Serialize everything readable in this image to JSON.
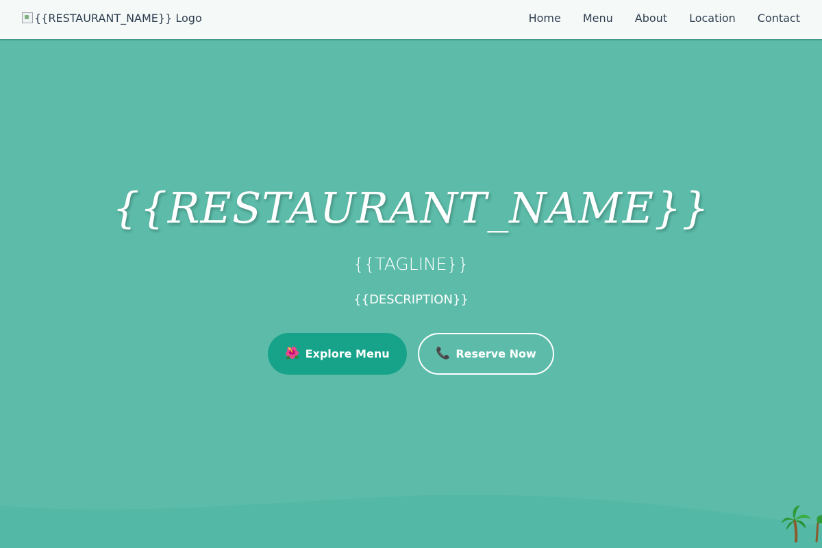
{
  "header": {
    "logo_alt": "{{RESTAURANT_NAME}} Logo",
    "nav": [
      {
        "label": "Home"
      },
      {
        "label": "Menu"
      },
      {
        "label": "About"
      },
      {
        "label": "Location"
      },
      {
        "label": "Contact"
      }
    ]
  },
  "hero": {
    "title": "{{RESTAURANT_NAME}}",
    "tagline": "{{TAGLINE}}",
    "description": "{{DESCRIPTION}}",
    "primary_button": {
      "icon": "🌺",
      "label": "Explore Menu",
      "icon_name": "hibiscus-icon"
    },
    "secondary_button": {
      "icon": "📞",
      "label": "Reserve Now",
      "icon_name": "phone-icon"
    }
  },
  "colors": {
    "hero_bg": "#5cbca9",
    "nav_bg": "#f5f9f8",
    "primary_button": "#17a28a",
    "nav_text": "#2f3e4f",
    "wave": "#54b8a6"
  },
  "decor": {
    "corner_icon": "palm-tree-icon"
  }
}
